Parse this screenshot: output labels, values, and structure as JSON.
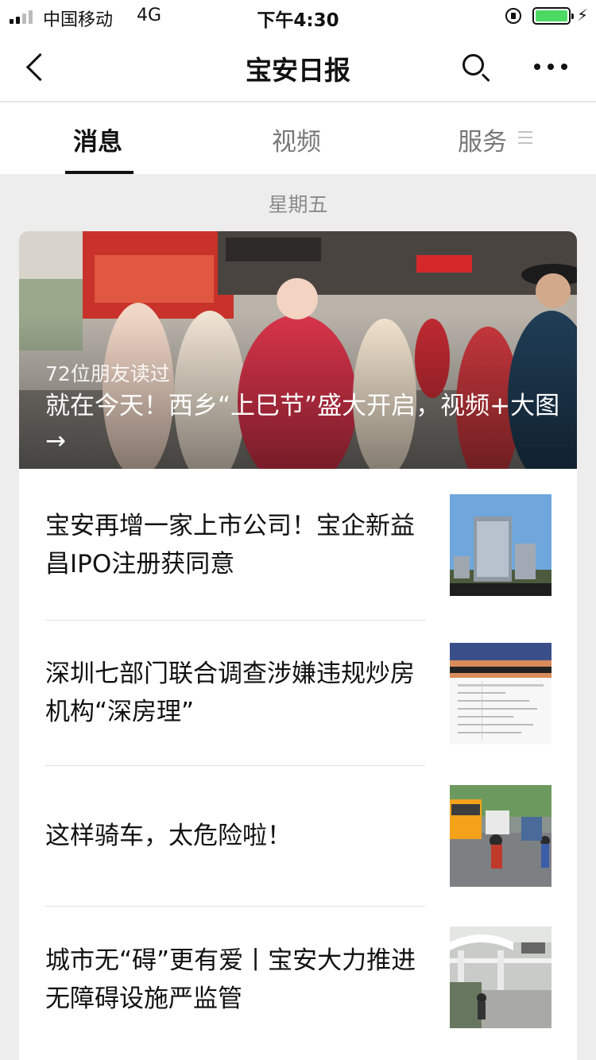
{
  "status_bar": {
    "carrier": "中国移动",
    "network": "4G",
    "time": "下午4:30",
    "battery_level": 1.0
  },
  "nav": {
    "title": "宝安日报",
    "back_icon": "chevron-left-icon",
    "search_icon": "search-icon",
    "more_icon": "more-dots-icon"
  },
  "tabs": [
    {
      "label": "消息",
      "active": true
    },
    {
      "label": "视频",
      "active": false
    },
    {
      "label": "服务",
      "active": false
    }
  ],
  "date_label": "星期五",
  "hero": {
    "readers": "72位朋友读过",
    "title": "就在今天！西乡“上巳节”盛大开启，视频+大图→"
  },
  "articles": [
    {
      "title": "宝安再增一家上市公司！宝企新益昌IPO注册获同意"
    },
    {
      "title": "深圳七部门联合调查涉嫌违规炒房机构“深房理”"
    },
    {
      "title": "这样骑车，太危险啦！"
    },
    {
      "title": "城市无“碍”更有爱丨宝安大力推进无障碍设施严监管"
    }
  ],
  "colors": {
    "accent": "#111111",
    "battery": "#4cd964",
    "background": "#ededed"
  }
}
